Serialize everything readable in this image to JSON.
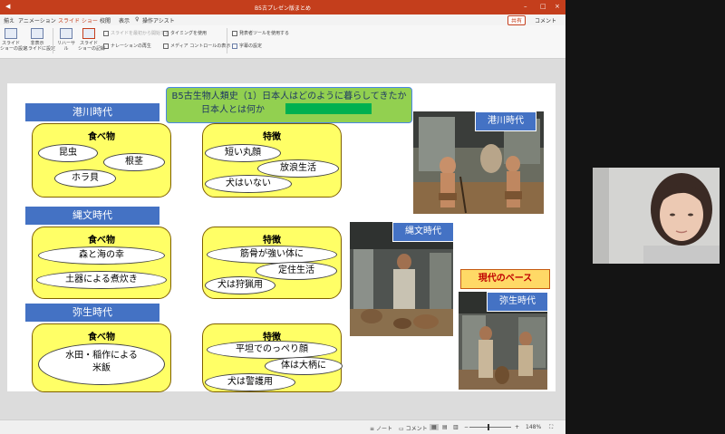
{
  "window": {
    "title": "B5古プレゼン版まとめ",
    "controls": {
      "minimize": "–",
      "maximize": "□",
      "close": "×"
    }
  },
  "menubar": {
    "items": [
      {
        "label": "揃え"
      },
      {
        "label": "アニメーション"
      },
      {
        "label": "スライド ショー",
        "active": true
      },
      {
        "label": "校閲"
      },
      {
        "label": "表示"
      },
      {
        "label": "操作アシスト"
      }
    ],
    "share_label": "共有",
    "comment_label": "コメント"
  },
  "ribbon": {
    "buttons": [
      {
        "label": "スライド\nショーの設定"
      },
      {
        "label": "非表示\nスライドに設定"
      },
      {
        "label": "リハーサル"
      },
      {
        "label": "スライド\nショーの記録"
      }
    ],
    "checks": [
      {
        "label": "スライドを最初から開始する"
      },
      {
        "label": "ナレーションの再生"
      },
      {
        "label": "タイミングを使用"
      },
      {
        "label": "メディア コントロールの表示"
      },
      {
        "label": "発表者ツールを使用する"
      },
      {
        "label": "字幕の設定"
      }
    ]
  },
  "slide": {
    "title_line1": "B5古生物人類史（1）日本人はどのように暮らしてきたか",
    "title_line2": "日本人とは何か",
    "sections": [
      {
        "header": "港川時代",
        "food_title": "食べ物",
        "foods": [
          "昆虫",
          "根茎",
          "ホラ貝"
        ],
        "feature_title": "特徴",
        "features": [
          "短い丸顔",
          "放浪生活",
          "犬はいない"
        ]
      },
      {
        "header": "縄文時代",
        "food_title": "食べ物",
        "foods": [
          "森と海の幸",
          "土器による煮炊き"
        ],
        "feature_title": "特徴",
        "features": [
          "筋骨が強い体に",
          "定住生活",
          "犬は狩猟用"
        ]
      },
      {
        "header": "弥生時代",
        "food_title": "食べ物",
        "foods": [
          "水田・稲作による\n米飯"
        ],
        "feature_title": "特徴",
        "features": [
          "平坦でのっぺり顔",
          "体は大柄に",
          "犬は警護用"
        ]
      }
    ],
    "photo_tags": [
      "港川時代",
      "縄文時代",
      "弥生時代"
    ],
    "modern_label": "現代のベース"
  },
  "statusbar": {
    "notes_label": "ノート",
    "comments_label": "コメント",
    "zoom": "148%"
  },
  "colors": {
    "brand": "#c43e1c",
    "section_header": "#4472c4",
    "title_fill": "#92d050",
    "title_highlight": "#00b050",
    "box_fill": "#ffff66",
    "modern_fill": "#ffd966"
  }
}
